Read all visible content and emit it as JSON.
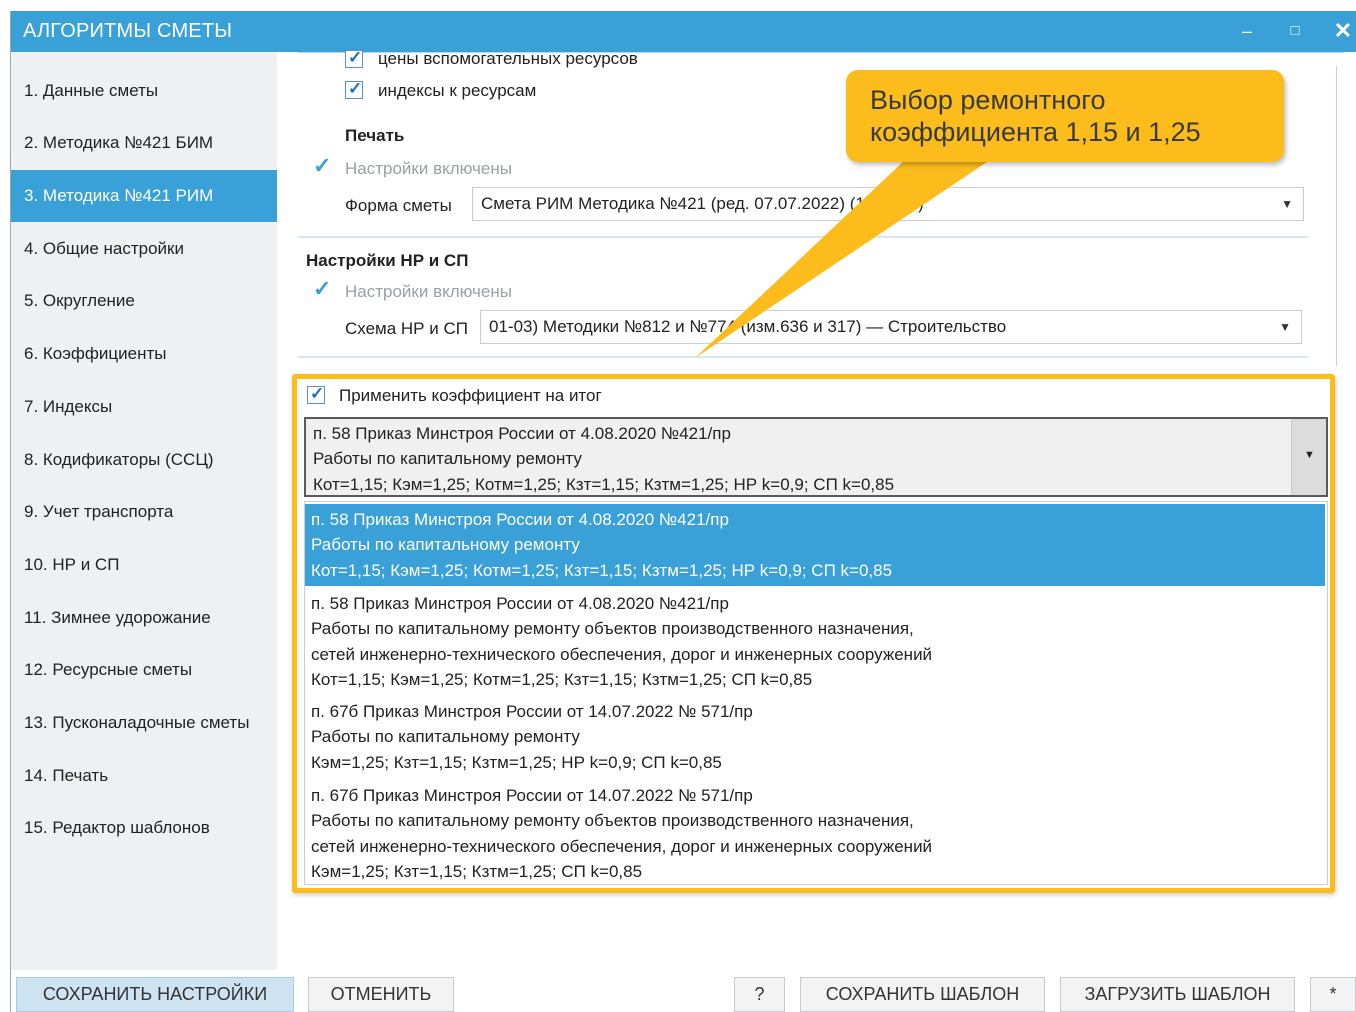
{
  "window": {
    "title": "АЛГОРИТМЫ СМЕТЫ"
  },
  "sidebar": {
    "items": [
      {
        "label": "1. Данные сметы"
      },
      {
        "label": "2. Методика №421 БИМ"
      },
      {
        "label": "3. Методика №421 РИМ"
      },
      {
        "label": "4. Общие настройки"
      },
      {
        "label": "5. Округление"
      },
      {
        "label": "6. Коэффициенты"
      },
      {
        "label": "7. Индексы"
      },
      {
        "label": "8. Кодификаторы (ССЦ)"
      },
      {
        "label": "9. Учет транспорта"
      },
      {
        "label": "10. НР и СП"
      },
      {
        "label": "11. Зимнее удорожание"
      },
      {
        "label": "12. Ресурсные сметы"
      },
      {
        "label": "13. Пусконаладочные сметы"
      },
      {
        "label": "14. Печать"
      },
      {
        "label": "15. Редактор шаблонов"
      }
    ]
  },
  "content": {
    "cb_aux_prices": "цены вспомогательных ресурсов",
    "cb_res_indexes": "индексы к ресурсам",
    "print_heading": "Печать",
    "print_enabled": "Настройки включены",
    "form_label": "Форма сметы",
    "form_value": "Смета РИМ Методика №421 (ред. 07.07.2022) (12 граф)",
    "nrsp_heading": "Настройки НР и СП",
    "nrsp_enabled": "Настройки включены",
    "scheme_label": "Схема НР и СП",
    "scheme_value": "01-03) Методики №812 и №774 (изм.636 и 317) — Строительство",
    "apply_coef": "Применить коэффициент на итог"
  },
  "callout": {
    "line1": "Выбор ремонтного",
    "line2": "коэффициента 1,15 и 1,25"
  },
  "dropdown": {
    "selected": [
      "п. 58 Приказ Минстроя России от 4.08.2020 №421/пр",
      "Работы по капитальному ремонту",
      "Кот=1,15; Кэм=1,25; Котм=1,25; Кзт=1,15; Кзтм=1,25; НР k=0,9; СП k=0,85"
    ],
    "options": [
      {
        "lines": [
          "п. 58 Приказ Минстроя России от 4.08.2020 №421/пр",
          "Работы по капитальному ремонту",
          "Кот=1,15; Кэм=1,25; Котм=1,25; Кзт=1,15; Кзтм=1,25; НР k=0,9; СП k=0,85"
        ]
      },
      {
        "lines": [
          "п. 58 Приказ Минстроя России от 4.08.2020 №421/пр",
          "Работы по капитальному ремонту объектов производственного назначения,",
          "сетей инженерно-технического обеспечения, дорог и инженерных сооружений",
          "Кот=1,15; Кэм=1,25; Котм=1,25; Кзт=1,15; Кзтм=1,25; СП k=0,85"
        ]
      },
      {
        "lines": [
          "п. 67б Приказ Минстроя России от 14.07.2022 № 571/пр",
          "Работы по капитальному ремонту",
          "Кэм=1,25; Кзт=1,15; Кзтм=1,25; НР k=0,9; СП k=0,85"
        ]
      },
      {
        "lines": [
          "п. 67б Приказ Минстроя России от 14.07.2022 № 571/пр",
          "Работы по капитальному ремонту объектов производственного назначения,",
          "сетей инженерно-технического обеспечения, дорог и инженерных сооружений",
          "Кэм=1,25; Кзт=1,15; Кзтм=1,25; СП k=0,85"
        ]
      }
    ]
  },
  "footer": {
    "save_settings": "СОХРАНИТЬ НАСТРОЙКИ",
    "cancel": "ОТМЕНИТЬ",
    "help": "?",
    "save_template": "СОХРАНИТЬ ШАБЛОН",
    "load_template": "ЗАГРУЗИТЬ ШАБЛОН",
    "star": "*"
  },
  "icons": {
    "check": "check-icon",
    "chevron": "chevron-down-icon",
    "minimize": "minimize-icon",
    "maximize": "maximize-icon",
    "close": "close-icon"
  },
  "colors": {
    "accent": "#3aa0d8",
    "callout": "#fbbc1c"
  }
}
